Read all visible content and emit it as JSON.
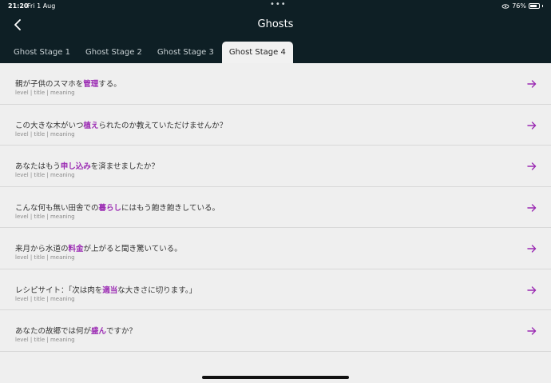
{
  "status_bar": {
    "time": "21:20",
    "date": "Fri 1 Aug",
    "dots": "•••",
    "battery_text": "76%",
    "battery_level": 0.76
  },
  "nav": {
    "title": "Ghosts",
    "back_icon": "chevron-left-icon"
  },
  "tabs": [
    {
      "label": "Ghost Stage 1",
      "active": false
    },
    {
      "label": "Ghost Stage 2",
      "active": false
    },
    {
      "label": "Ghost Stage 3",
      "active": false
    },
    {
      "label": "Ghost Stage 4",
      "active": true
    }
  ],
  "items": [
    {
      "before": "親が子供のスマホを",
      "highlight": "管理",
      "after": "する。",
      "sub": "level | title | meaning"
    },
    {
      "before": "この大きな木がいつ",
      "highlight": "植え",
      "after": "られたのか教えていただけませんか？",
      "sub": "level | title | meaning"
    },
    {
      "before": "あなたはもう",
      "highlight": "申し込み",
      "after": "を済ませましたか？",
      "sub": "level | title | meaning"
    },
    {
      "before": "こんな何も無い田舎での",
      "highlight": "暮らし",
      "after": "にはもう飽き飽きしている。",
      "sub": "level | title | meaning"
    },
    {
      "before": "来月から水道の",
      "highlight": "料金",
      "after": "が上がると聞き驚いている。",
      "sub": "level | title | meaning"
    },
    {
      "before": "レシピサイト：「次は肉を",
      "highlight": "適当",
      "after": "な大きさに切ります。」",
      "sub": "level | title | meaning"
    },
    {
      "before": "あなたの故郷では何が",
      "highlight": "盛ん",
      "after": "ですか？",
      "sub": "level | title | meaning"
    }
  ],
  "colors": {
    "header_bg": "#0e1f25",
    "accent": "#9b2bb3",
    "list_bg": "#efefef"
  }
}
